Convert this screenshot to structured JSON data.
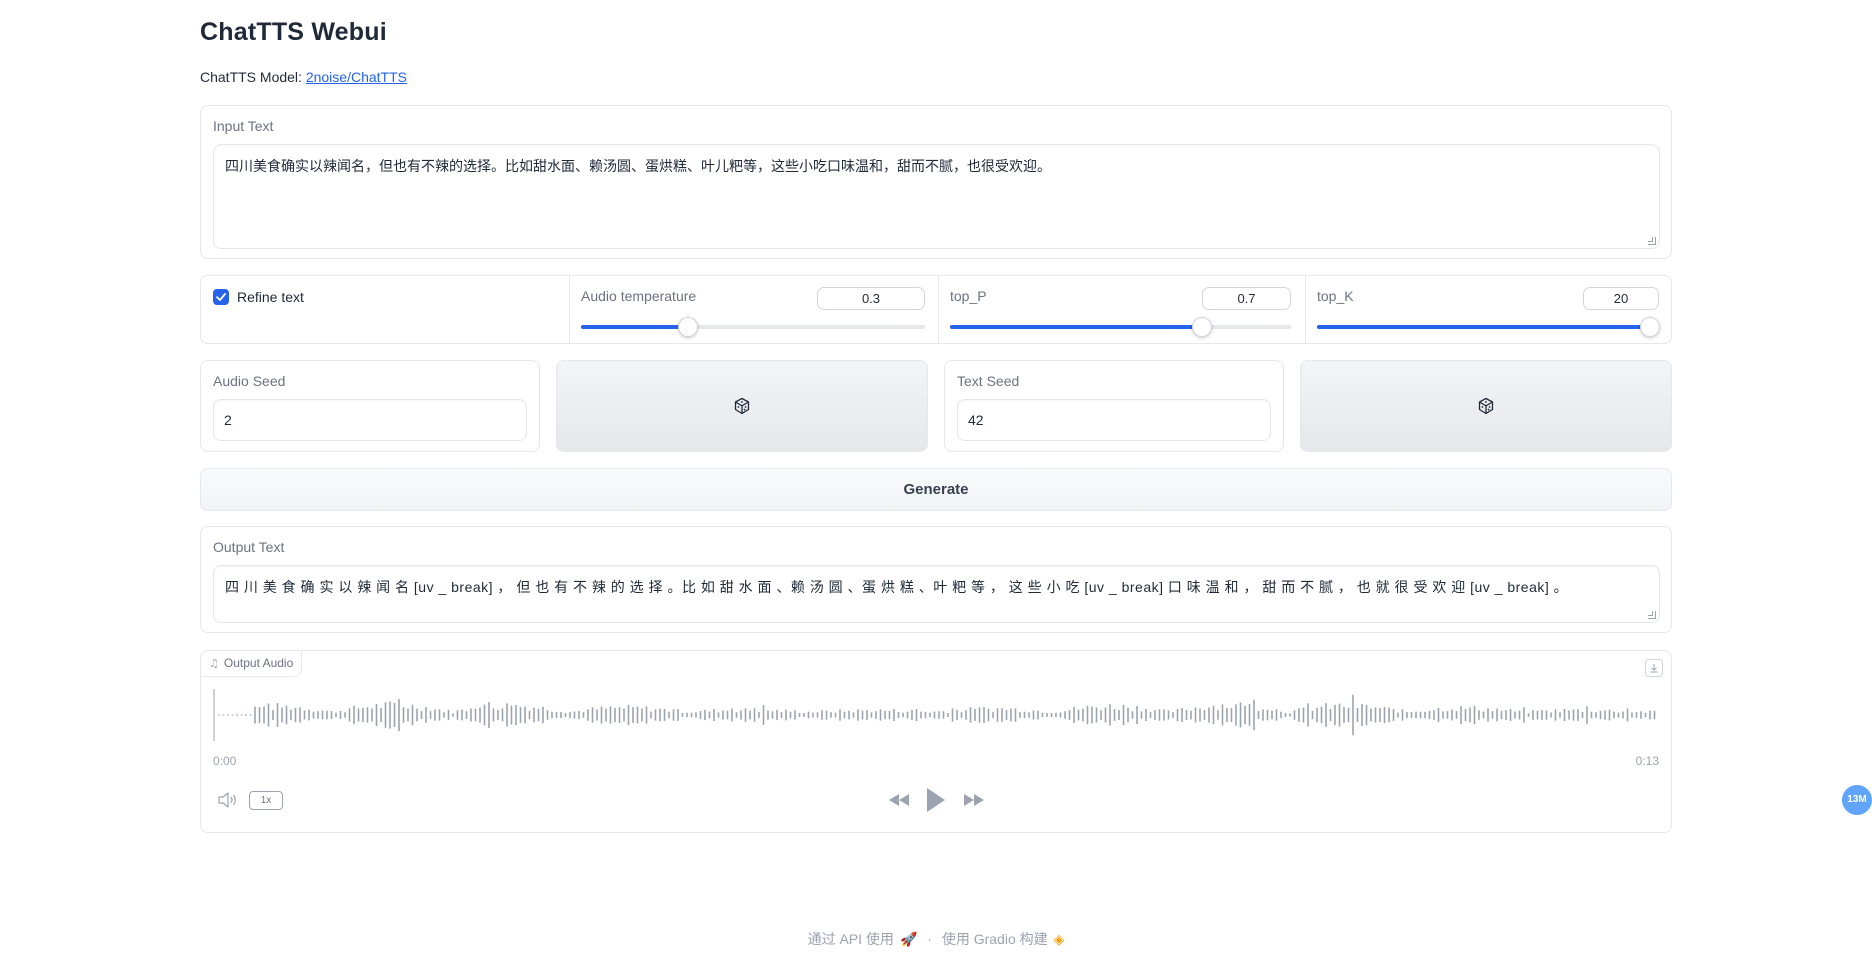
{
  "header": {
    "title": "ChatTTS Webui",
    "model_prefix": "ChatTTS Model: ",
    "model_link": "2noise/ChatTTS"
  },
  "input_text": {
    "label": "Input Text",
    "value": "四川美食确实以辣闻名，但也有不辣的选择。比如甜水面、赖汤圆、蛋烘糕、叶儿粑等，这些小吃口味温和，甜而不腻，也很受欢迎。"
  },
  "controls": {
    "refine_text": {
      "label": "Refine text",
      "checked": true
    },
    "audio_temperature": {
      "label": "Audio temperature",
      "value": "0.3",
      "fraction": 0.3
    },
    "top_p": {
      "label": "top_P",
      "value": "0.7",
      "fraction": 0.74
    },
    "top_k": {
      "label": "top_K",
      "value": "20",
      "fraction": 1.0
    }
  },
  "audio_seed": {
    "label": "Audio Seed",
    "value": "2"
  },
  "text_seed": {
    "label": "Text Seed",
    "value": "42"
  },
  "dice_icon": "dice-icon",
  "generate_label": "Generate",
  "output_text": {
    "label": "Output Text",
    "value": "四 川 美 食 确 实 以 辣 闻 名 [uv _ break] ， 但 也 有 不 辣 的 选 择 。比 如 甜 水 面 、赖 汤 圆 、蛋 烘 糕 、叶 粑 等 ， 这 些 小 吃 [uv _ break] 口 味 温 和 ， 甜 而 不 腻 ， 也 就 很 受 欢 迎 [uv _ break] 。"
  },
  "output_audio": {
    "label": "Output Audio",
    "time_start": "0:00",
    "time_end": "0:13",
    "speed": "1x"
  },
  "footer": {
    "api": "通过 API 使用",
    "sep": "·",
    "built": "使用 Gradio 构建"
  },
  "badge": "13M",
  "colors": {
    "accent": "#2563eb",
    "wave": "#9ca3af"
  }
}
